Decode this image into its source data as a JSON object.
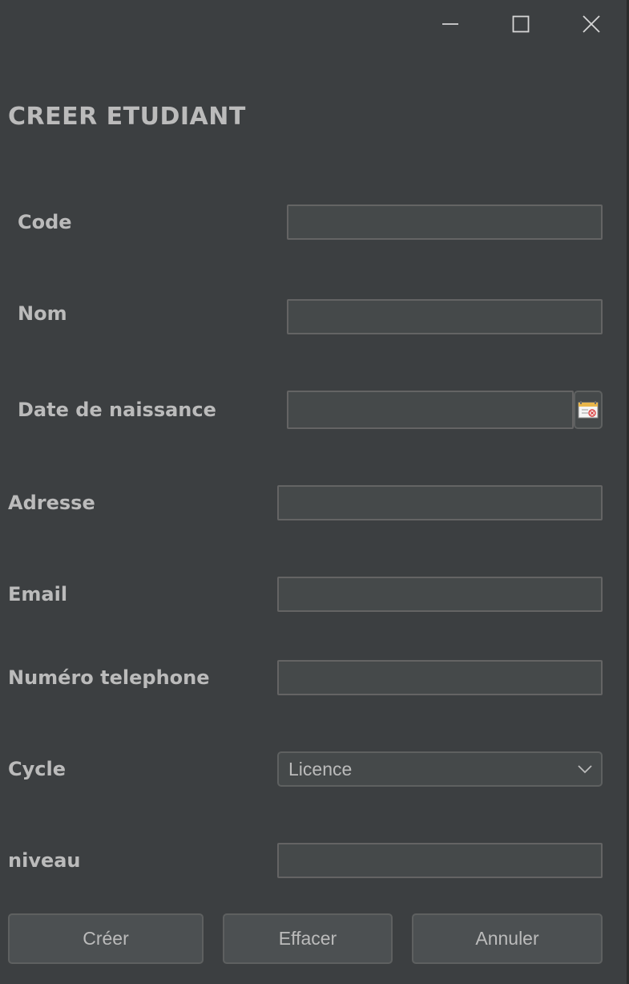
{
  "form": {
    "title": "CREER ETUDIANT",
    "fields": {
      "code": {
        "label": "Code",
        "value": ""
      },
      "nom": {
        "label": "Nom",
        "value": ""
      },
      "date_naissance": {
        "label": "Date de naissance",
        "value": ""
      },
      "adresse": {
        "label": "Adresse",
        "value": ""
      },
      "email": {
        "label": "Email",
        "value": ""
      },
      "telephone": {
        "label": "Numéro telephone",
        "value": ""
      },
      "cycle": {
        "label": "Cycle",
        "value": "Licence"
      },
      "niveau": {
        "label": "niveau",
        "value": ""
      }
    }
  },
  "buttons": {
    "create": "Créer",
    "clear": "Effacer",
    "cancel": "Annuler"
  },
  "icons": {
    "minimize": "minimize-icon",
    "maximize": "maximize-icon",
    "close": "close-icon",
    "calendar": "calendar-icon",
    "dropdown": "chevron-down-icon"
  },
  "colors": {
    "background": "#3c3f41",
    "field": "#45494a",
    "text": "#bbbbbb",
    "button": "#4c5052"
  }
}
